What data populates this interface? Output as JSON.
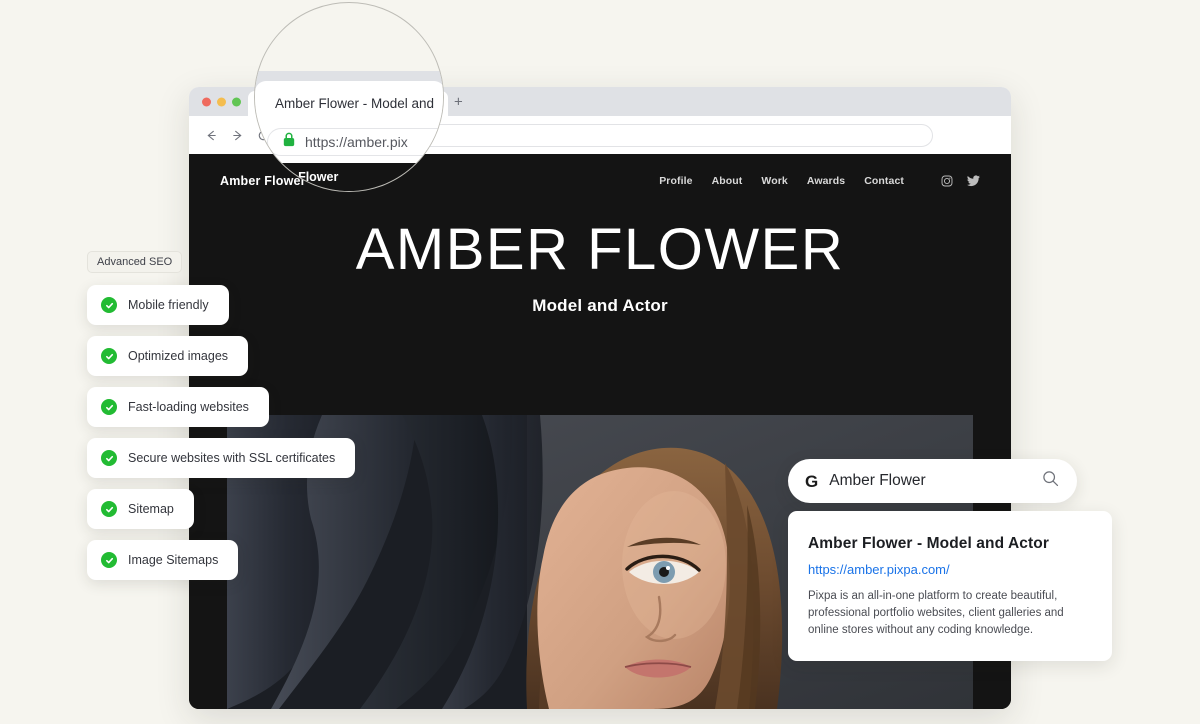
{
  "page": {
    "background_color": "#f6f5ef"
  },
  "browser": {
    "tab_title": "Amber Flower - Model and",
    "new_tab_label": "+",
    "url": "https://amber.pix",
    "lens_url": "https://amber.pix",
    "lock_icon": "lock-icon",
    "back_icon": "arrow-left-icon",
    "forward_icon": "arrow-right-icon",
    "reload_icon": "reload-icon",
    "traffic_lights": [
      {
        "name": "close",
        "color": "#ef6a5e"
      },
      {
        "name": "minimize",
        "color": "#f4bd4f"
      },
      {
        "name": "maximize",
        "color": "#61c554"
      }
    ]
  },
  "site": {
    "logo": "Amber Flower",
    "lens_logo": "Amber Flower",
    "nav": [
      {
        "label": "Profile"
      },
      {
        "label": "About"
      },
      {
        "label": "Work"
      },
      {
        "label": "Awards"
      },
      {
        "label": "Contact"
      }
    ],
    "social": [
      {
        "name": "instagram-icon"
      },
      {
        "name": "twitter-icon"
      }
    ],
    "hero": {
      "title": "AMBER FLOWER",
      "subtitle": "Model and Actor"
    }
  },
  "seo": {
    "tag": "Advanced SEO",
    "accent_color": "#22bb33",
    "features": [
      {
        "label": "Mobile friendly"
      },
      {
        "label": "Optimized images"
      },
      {
        "label": "Fast-loading websites"
      },
      {
        "label": "Secure websites with SSL certificates"
      },
      {
        "label": "Sitemap"
      },
      {
        "label": "Image Sitemaps"
      }
    ]
  },
  "google": {
    "brand_letter": "G",
    "query": "Amber Flower",
    "search_icon": "search-icon",
    "result": {
      "title": "Amber Flower -  Model and Actor",
      "url": "https://amber.pixpa.com/",
      "url_color": "#1a73e8",
      "description": "Pixpa is an all-in-one platform to create beautiful, professional portfolio websites, client galleries and online stores without any coding knowledge."
    }
  }
}
